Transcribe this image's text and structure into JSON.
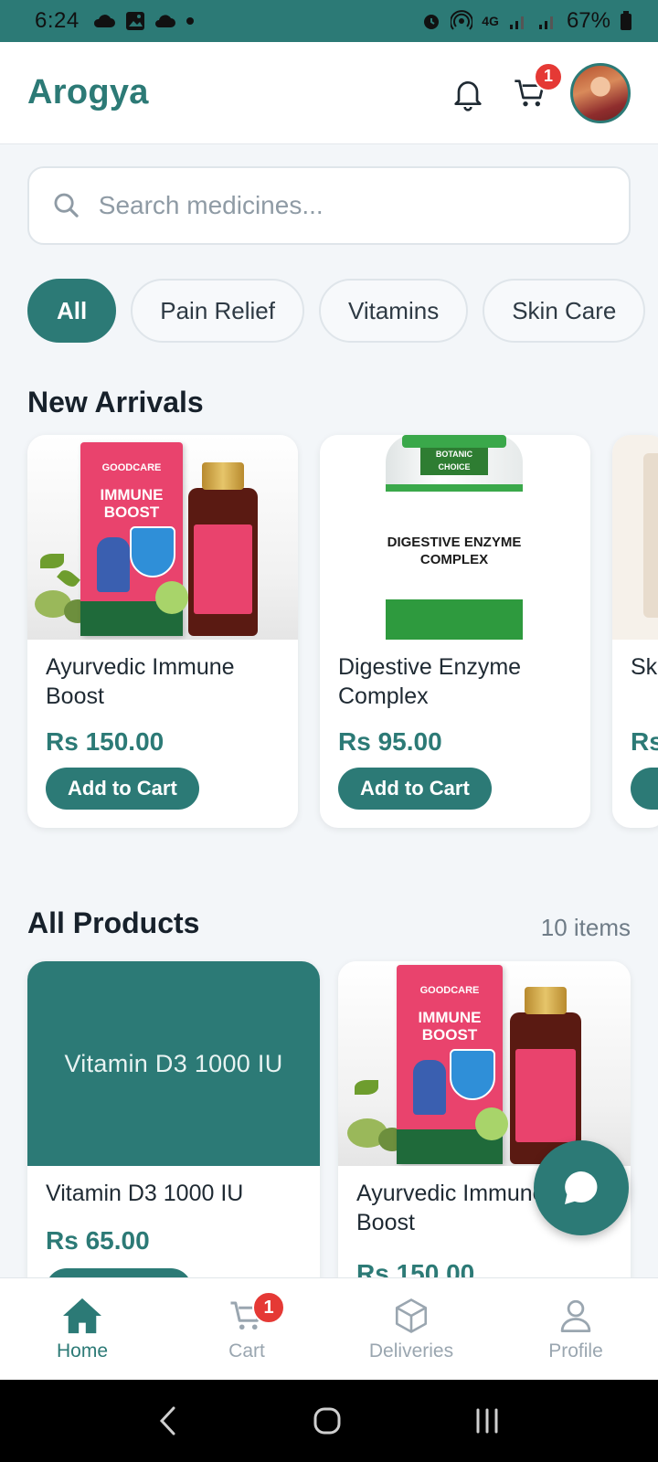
{
  "status_bar": {
    "time": "6:24",
    "network": "4G",
    "battery": "67%"
  },
  "header": {
    "brand": "Arogya",
    "cart_badge": "1"
  },
  "search": {
    "placeholder": "Search medicines..."
  },
  "chips": [
    {
      "label": "All",
      "active": true
    },
    {
      "label": "Pain Relief",
      "active": false
    },
    {
      "label": "Vitamins",
      "active": false
    },
    {
      "label": "Skin Care",
      "active": false
    }
  ],
  "new_arrivals": {
    "title": "New Arrivals",
    "items": [
      {
        "name": "Ayurvedic Immune Boost",
        "price": "Rs 150.00",
        "button": "Add to Cart",
        "image_text": {
          "brand": "GOODCARE",
          "product": "IMMUNE BOOST"
        }
      },
      {
        "name": "Digestive Enzyme Complex",
        "price": "Rs 95.00",
        "button": "Add to Cart",
        "image_text": {
          "brand": "BOTANIC CHOICE",
          "product": "DIGESTIVE ENZYME COMPLEX"
        }
      },
      {
        "name": "Sk",
        "price": "Rs"
      }
    ]
  },
  "all_products": {
    "title": "All Products",
    "count": "10 items",
    "items": [
      {
        "name": "Vitamin D3 1000 IU",
        "image_placeholder": "Vitamin D3 1000 IU",
        "price": "Rs 65.00"
      },
      {
        "name": "Ayurvedic Immune Boost",
        "price": "Rs 150.00"
      }
    ]
  },
  "bottom_nav": [
    {
      "label": "Home",
      "icon": "home-icon",
      "active": true
    },
    {
      "label": "Cart",
      "icon": "cart-icon",
      "badge": "1",
      "active": false
    },
    {
      "label": "Deliveries",
      "icon": "box-icon",
      "active": false
    },
    {
      "label": "Profile",
      "icon": "person-icon",
      "active": false
    }
  ],
  "colors": {
    "primary": "#2c7a76",
    "badge": "#e53935",
    "background": "#f3f6f9"
  }
}
